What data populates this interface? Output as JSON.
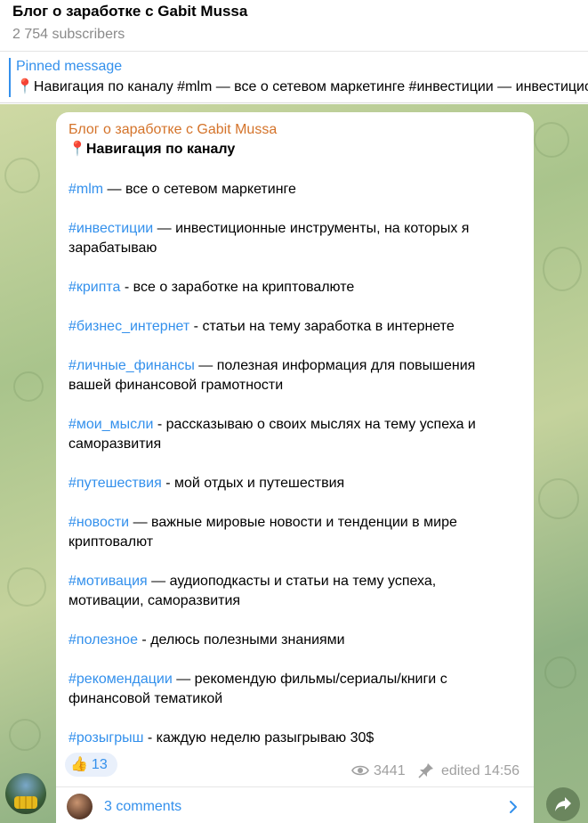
{
  "header": {
    "title": "Блог о заработке с Gabit Mussa",
    "subscribers": "2 754 subscribers"
  },
  "pinned": {
    "title": "Pinned message",
    "text": "📍Навигация по каналу  #mlm — все о сетевом маркетинге  #инвестиции — инвестиционные"
  },
  "message": {
    "author": "Блог о заработке с Gabit Mussa",
    "heading_emoji": "📍",
    "heading": "Навигация по каналу",
    "items": [
      {
        "tag": "#mlm",
        "rest": " — все о сетевом маркетинге"
      },
      {
        "tag": "#инвестиции",
        "rest": " — инвестиционные инструменты, на которых я зарабатываю"
      },
      {
        "tag": "#крипта",
        "rest": " - все о заработке на криптовалюте"
      },
      {
        "tag": "#бизнес_интернет",
        "rest": " - статьи на тему заработка в интернете"
      },
      {
        "tag": "#личные_финансы",
        "rest": " — полезная информация для повышения вашей финансовой грамотности"
      },
      {
        "tag": "#мои_мысли",
        "rest": " - рассказываю о своих мыслях на тему успеха и саморазвития"
      },
      {
        "tag": "#путешествия",
        "rest": " - мой отдых и путешествия"
      },
      {
        "tag": "#новости",
        "rest": " — важные мировые новости и тенденции в мире криптовалют"
      },
      {
        "tag": "#мотивация",
        "rest": " — аудиоподкасты и статьи на тему успеха, мотивации, саморазвития"
      },
      {
        "tag": "#полезное",
        "rest": " - делюсь полезными знаниями"
      },
      {
        "tag": "#рекомендации",
        "rest": " — рекомендую фильмы/сериалы/книги с финансовой тематикой"
      },
      {
        "tag": "#розыгрыш",
        "rest": " - каждую неделю разыгрываю 30$"
      }
    ],
    "reaction_emoji": "👍",
    "reaction_count": "13",
    "views": "3441",
    "edited": "edited 14:56",
    "comments": "3 comments"
  },
  "colors": {
    "accent": "#3390ec",
    "author": "#d4732a"
  }
}
